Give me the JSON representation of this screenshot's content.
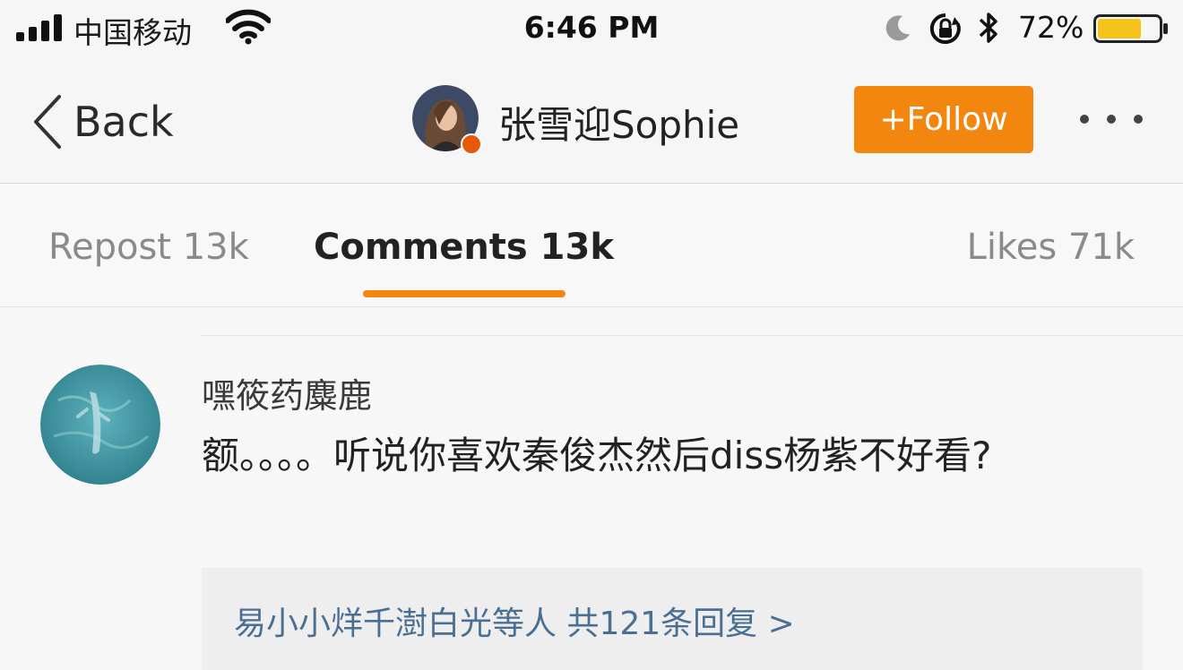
{
  "status_bar": {
    "carrier": "中国移动",
    "time": "6:46 PM",
    "battery_percent": "72%",
    "battery_level": 0.72,
    "battery_color": "#f6c21c",
    "icons": [
      "signal-icon",
      "wifi-icon",
      "moon-icon",
      "rotation-lock-icon",
      "bluetooth-icon",
      "battery-icon"
    ]
  },
  "nav": {
    "back_label": "Back",
    "username": "张雪迎Sophie",
    "follow_label": "+Follow",
    "accent_color": "#f3860e"
  },
  "tabs": [
    {
      "label": "Repost 13k",
      "active": false
    },
    {
      "label": "Comments 13k",
      "active": true
    },
    {
      "label": "Likes 71k",
      "active": false
    }
  ],
  "comment": {
    "author": "嘿筱药麋鹿",
    "text": "额。。。。听说你喜欢秦俊杰然后diss杨紫不好看?",
    "replies_summary": "易小小烊千澍白光等人  共121条回复 >",
    "link_color": "#4a6f93"
  }
}
